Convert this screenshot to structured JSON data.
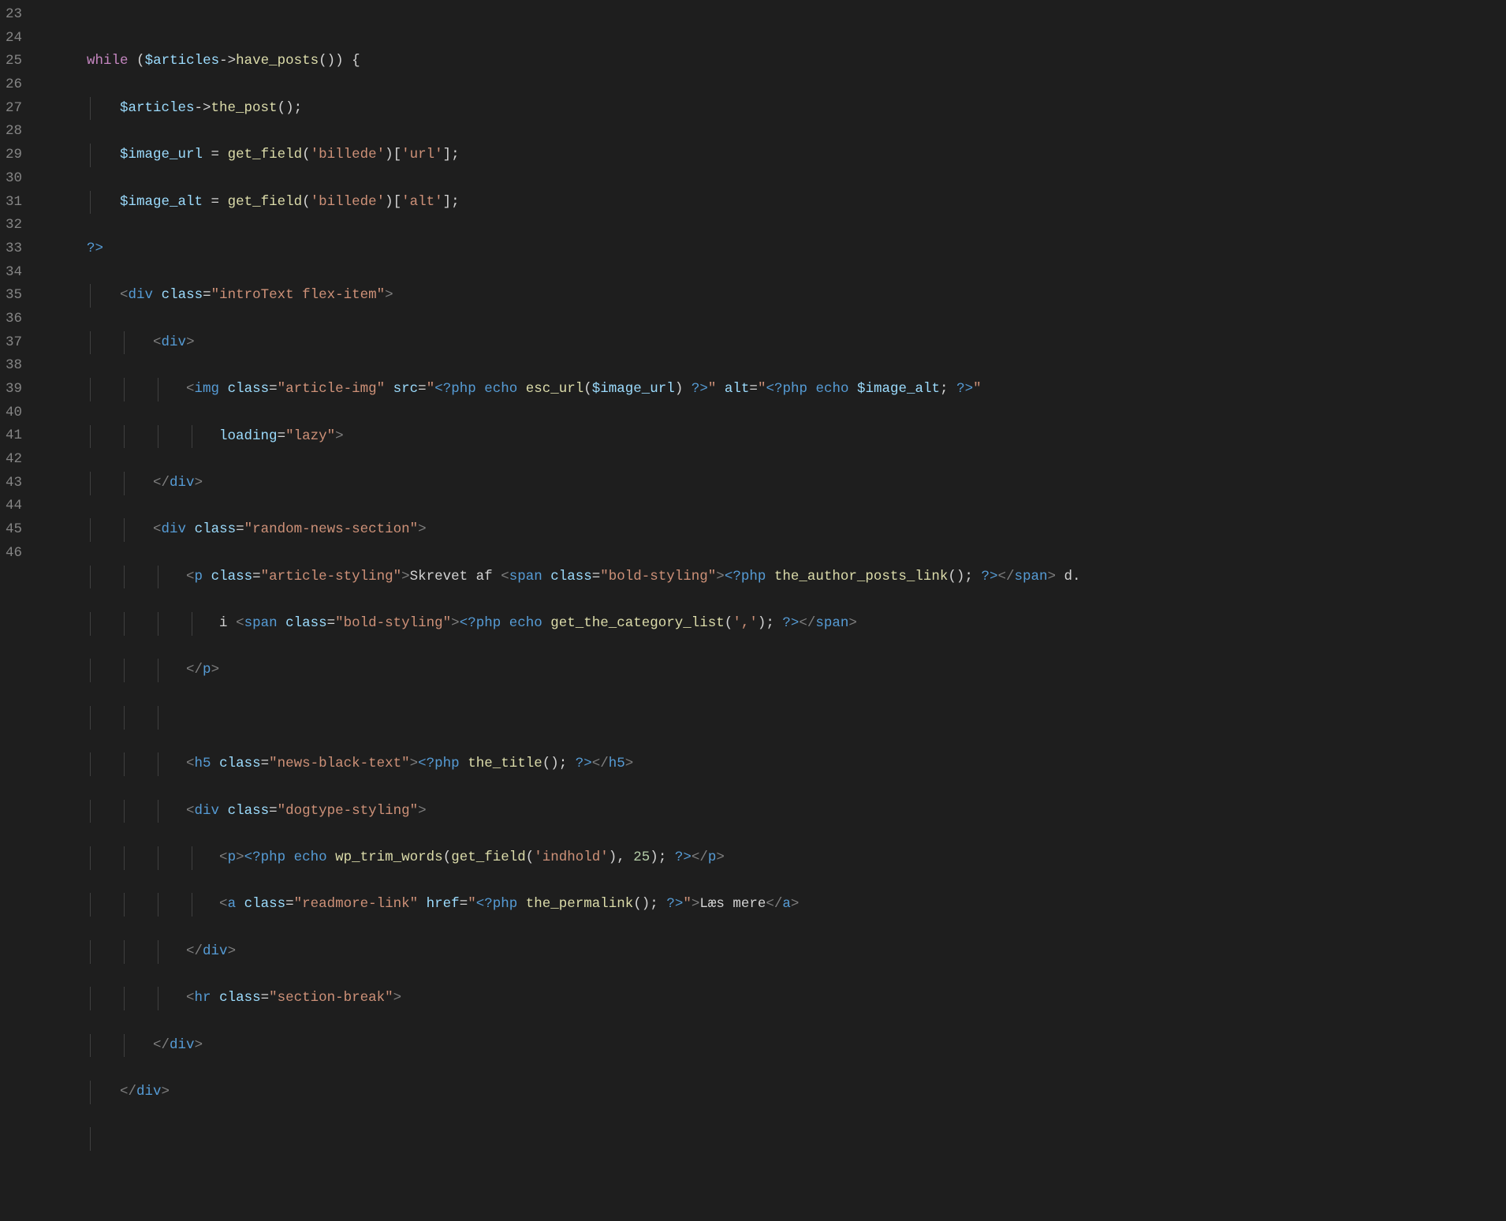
{
  "gutter": {
    "l23": "23",
    "l24": "24",
    "l25": "25",
    "l26": "26",
    "l27": "27",
    "l28": "28",
    "l29": "29",
    "l30": "30",
    "l31": "31",
    "l32": "32",
    "l33": "33",
    "l34": "34",
    "l35": "35",
    "l36": "36",
    "l37": "37",
    "l38": "38",
    "l39": "39",
    "l40": "40",
    "l41": "41",
    "l42": "42",
    "l43": "43",
    "l44": "44",
    "l45": "45",
    "l46": "46"
  },
  "tok": {
    "while": "while",
    "open_paren": "(",
    "close_paren": ")",
    "open_brace": " {",
    "close_brace_arrow": "->",
    "arrow": "->",
    "semi": ";",
    "eq": " = ",
    "lbracket": "[",
    "rbracket": "]",
    "close_php": "?>",
    "open_php": "<?php",
    "lt": "<",
    "gt": ">",
    "ltslash": "</",
    "slashgt": ">",
    "comma_sp": ", ",
    "dot_sp": " d.",
    "colon_sp": ": ",
    "space": " ",
    "v_articles": "$articles",
    "v_image_url": "$image_url",
    "v_image_alt": "$image_alt",
    "f_have_posts": "have_posts",
    "f_the_post": "the_post",
    "f_get_field": "get_field",
    "f_esc_url": "esc_url",
    "f_the_author": "the_author_posts_link",
    "f_get_cat": "get_the_category_list",
    "f_the_title": "the_title",
    "f_wp_trim": "wp_trim_words",
    "f_permalink": "the_permalink",
    "s_billede": "'billede'",
    "s_url": "'url'",
    "s_alt": "'alt'",
    "s_indhold": "'indhold'",
    "s_comma": "','",
    "s_lazy": "\"lazy\"",
    "s_introText": "\"introText flex-item\"",
    "s_article_img": "\"article-img\"",
    "s_random_news": "\"random-news-section\"",
    "s_article_styling": "\"article-styling\"",
    "s_bold_styling": "\"bold-styling\"",
    "s_news_black": "\"news-black-text\"",
    "s_dogtype": "\"dogtype-styling\"",
    "s_readmore": "\"readmore-link\"",
    "s_section_break": "\"section-break\"",
    "s_src_open": "\"",
    "s_src_close": "\"",
    "s_alt_open": "\"",
    "s_alt_close": "\"",
    "s_href_open": "\"",
    "s_href_close": "\"",
    "n_25": "25",
    "echo": "echo",
    "t_div": "div",
    "t_img": "img",
    "t_p": "p",
    "t_span": "span",
    "t_h5": "h5",
    "t_a": "a",
    "t_hr": "hr",
    "a_class": "class",
    "a_src": "src",
    "a_alt": "alt",
    "a_loading": "loading",
    "a_href": "href",
    "txt_skrevet": "Skrevet af ",
    "txt_i": "i ",
    "txt_laes": "Læs mere"
  }
}
